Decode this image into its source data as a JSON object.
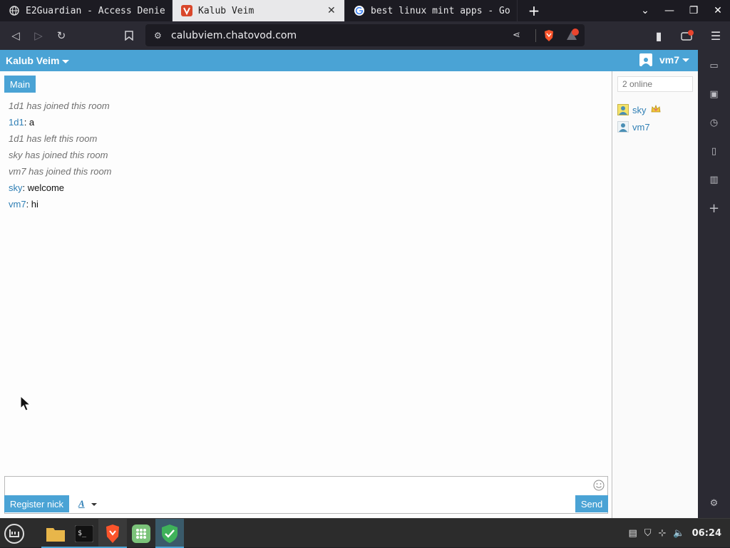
{
  "browser": {
    "tabs": [
      {
        "title": "E2Guardian - Access Denie",
        "favicon": "globe-icon",
        "active": false
      },
      {
        "title": "Kalub Veim",
        "favicon": "chatovod-icon",
        "active": true
      },
      {
        "title": "best linux mint apps - Go",
        "favicon": "google-icon",
        "active": false
      }
    ],
    "new_tab": "+",
    "url": "calubviem.chatovod.com",
    "rewards_badge": "",
    "accent": "#4aa3d5"
  },
  "chat": {
    "room_title": "Kalub Veim",
    "username": "vm7",
    "room_tab": "Main",
    "messages": [
      {
        "type": "system",
        "text": "1d1 has joined this room"
      },
      {
        "type": "user",
        "nick": "1d1",
        "text": ": a"
      },
      {
        "type": "system",
        "text": "1d1 has left this room"
      },
      {
        "type": "system",
        "text": "sky has joined this room"
      },
      {
        "type": "system",
        "text": "vm7 has joined this room"
      },
      {
        "type": "user",
        "nick": "sky",
        "text": ": welcome"
      },
      {
        "type": "user",
        "nick": "vm7",
        "text": ": hi"
      }
    ],
    "online_count": "2 online",
    "users": [
      {
        "nick": "sky",
        "role": "owner",
        "badge": "crown-icon"
      },
      {
        "nick": "vm7",
        "role": "user"
      }
    ],
    "register_button": "Register nick",
    "font_button": "A",
    "send_button": "Send"
  },
  "taskbar": {
    "clock": "06:24"
  }
}
